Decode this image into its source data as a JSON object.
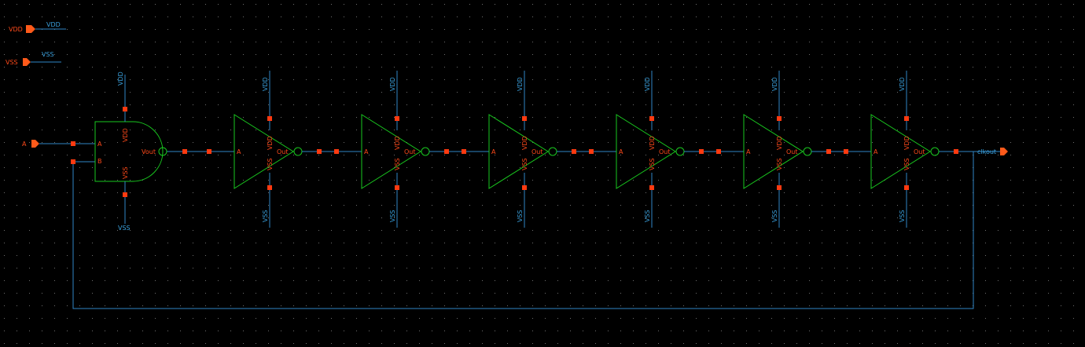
{
  "global_pins": {
    "vdd": {
      "label": "VDD",
      "net": "VDD"
    },
    "vss": {
      "label": "VSS",
      "net": "VSS"
    }
  },
  "input_port": {
    "label": "A"
  },
  "output_port": {
    "label": "clkout"
  },
  "nand_gate": {
    "pin_a": "A",
    "pin_b": "B",
    "pin_out": "Vout",
    "pin_vdd": "VDD",
    "pin_vss": "VSS",
    "net_vdd": "VDD",
    "net_vss": "VSS"
  },
  "inverters": [
    {
      "pin_in": "A",
      "pin_out": "Out",
      "pin_vdd": "VDD",
      "pin_vss": "VSS",
      "net_vdd": "VDD",
      "net_vss": "VSS"
    },
    {
      "pin_in": "A",
      "pin_out": "Out",
      "pin_vdd": "VDD",
      "pin_vss": "VSS",
      "net_vdd": "VDD",
      "net_vss": "VSS"
    },
    {
      "pin_in": "A",
      "pin_out": "Out",
      "pin_vdd": "VDD",
      "pin_vss": "VSS",
      "net_vdd": "VDD",
      "net_vss": "VSS"
    },
    {
      "pin_in": "A",
      "pin_out": "Out",
      "pin_vdd": "VDD",
      "pin_vss": "VSS",
      "net_vdd": "VDD",
      "net_vss": "VSS"
    },
    {
      "pin_in": "A",
      "pin_out": "Out",
      "pin_vdd": "VDD",
      "pin_vss": "VSS",
      "net_vdd": "VDD",
      "net_vss": "VSS"
    },
    {
      "pin_in": "A",
      "pin_out": "Out",
      "pin_vdd": "VDD",
      "pin_vss": "VSS",
      "net_vdd": "VDD",
      "net_vss": "VSS"
    }
  ],
  "colors": {
    "background": "#000000",
    "grid_dot": "#7a7a7a",
    "wire": "#2f86c6",
    "gate": "#19c81f",
    "pin": "#ff3a10",
    "label_red": "#ff4a1a",
    "label_blue": "#3aa0dd"
  }
}
